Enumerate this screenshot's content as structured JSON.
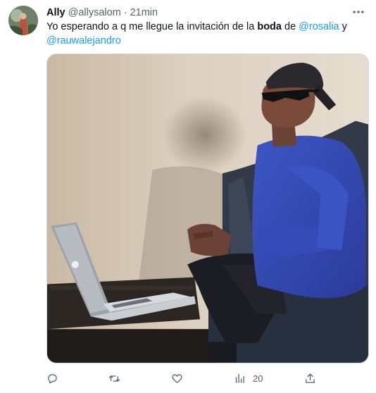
{
  "tweet": {
    "author_name": "Ally",
    "author_handle": "@allysalom",
    "separator": "·",
    "time": "21min",
    "text_part1": "Yo esperando a q me llegue la invitación de la ",
    "text_bold": "boda",
    "text_part2": " de ",
    "mention1": "@rosalia",
    "text_part3": " y",
    "mention2": "@rauwalejandro"
  },
  "actions": {
    "reply_icon": "reply-icon",
    "retweet_icon": "retweet-icon",
    "like_icon": "heart-icon",
    "views_icon": "views-icon",
    "views_count": "20",
    "share_icon": "share-icon"
  },
  "colors": {
    "link": "#1d9bf0",
    "secondary_text": "#536471",
    "primary_text": "#0f1419"
  }
}
